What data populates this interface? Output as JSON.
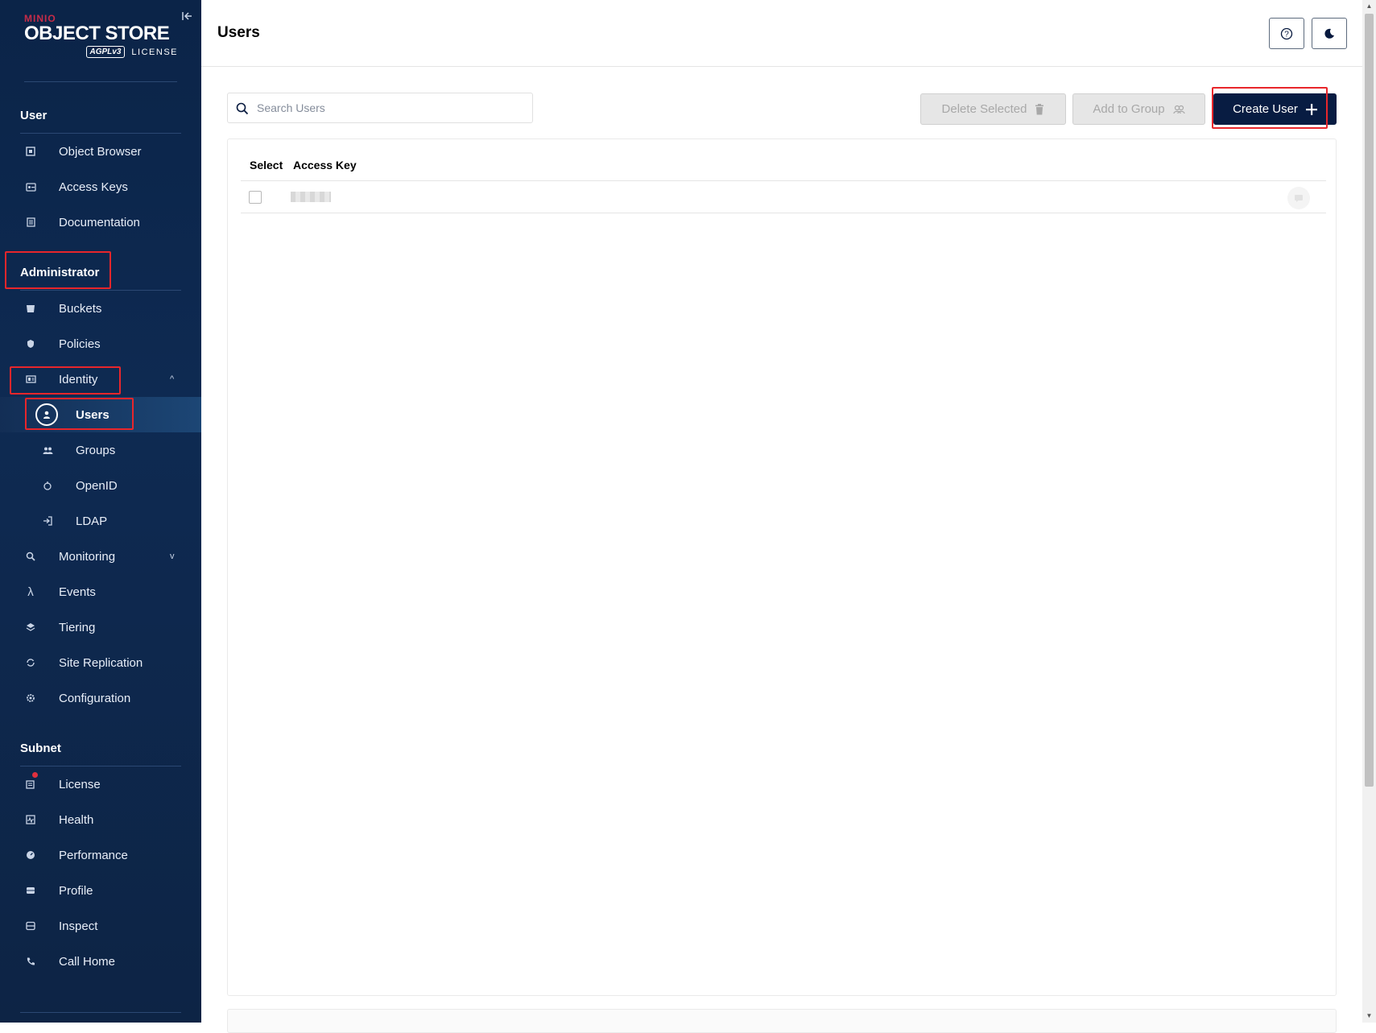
{
  "logo": {
    "brand": "MINIO",
    "product": "OBJECT STORE",
    "agpl": "AGPLv3",
    "license": "LICENSE"
  },
  "sidebar": {
    "sections": [
      {
        "title": "User",
        "items": [
          "Object Browser",
          "Access Keys",
          "Documentation"
        ]
      },
      {
        "title": "Administrator",
        "items": [
          "Buckets",
          "Policies",
          "Identity",
          "Users",
          "Groups",
          "OpenID",
          "LDAP",
          "Monitoring",
          "Events",
          "Tiering",
          "Site Replication",
          "Configuration"
        ]
      },
      {
        "title": "Subnet",
        "items": [
          "License",
          "Health",
          "Performance",
          "Profile",
          "Inspect",
          "Call Home"
        ]
      }
    ],
    "active_item": "Users",
    "expanded_item": "Identity",
    "icons": {
      "Object Browser": "object-browser-icon",
      "Access Keys": "key-icon",
      "Documentation": "docs-icon",
      "Buckets": "bucket-icon",
      "Policies": "shield-icon",
      "Identity": "id-card-icon",
      "Users": "user-icon",
      "Groups": "group-icon",
      "OpenID": "openid-icon",
      "LDAP": "login-icon",
      "Monitoring": "magnifier-icon",
      "Events": "lambda-icon",
      "Tiering": "layers-icon",
      "Site Replication": "sync-icon",
      "Configuration": "gear-icon",
      "License": "license-icon",
      "Health": "health-icon",
      "Performance": "gauge-icon",
      "Profile": "profile-icon",
      "Inspect": "inspect-icon",
      "Call Home": "phone-icon"
    }
  },
  "header": {
    "title": "Users"
  },
  "toolbar": {
    "search_placeholder": "Search Users",
    "delete_selected_label": "Delete Selected",
    "add_to_group_label": "Add to Group",
    "create_user_label": "Create User"
  },
  "table": {
    "columns": [
      "Select",
      "Access Key"
    ],
    "rows": [
      {
        "access_key": "",
        "selected": false
      }
    ]
  },
  "colors": {
    "sidebar_bg": "#0e2a52",
    "primary_button": "#081c42",
    "annotation": "#e8262b",
    "license_badge": "#e0303e"
  }
}
